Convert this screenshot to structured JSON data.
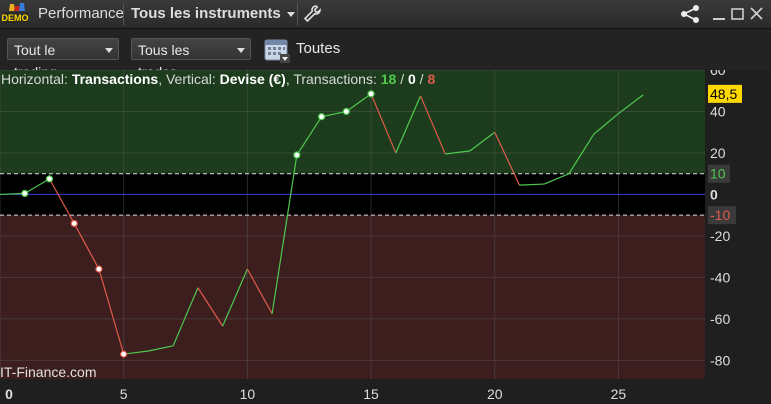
{
  "app": {
    "demo_badge": "DEMO",
    "tab_performance": "Performance",
    "tab_instruments": "Tous les instruments"
  },
  "toolbar": {
    "filter_trading": "Tout le trading",
    "filter_trades": "Tous les trades",
    "period_label": "Toutes"
  },
  "header": {
    "horizontal_label": "Horizontal: ",
    "horizontal_value": "Transactions",
    "vertical_label": ", Vertical: ",
    "vertical_value": "Devise (€)",
    "transactions_label": ", Transactions: ",
    "wins": "18",
    "sep1": " / ",
    "neutral": "0",
    "sep2": " / ",
    "losses": "8"
  },
  "watermark": "IT-Finance.com",
  "colors": {
    "win": "#4ec94e",
    "loss": "#e05a4a",
    "profit_zone": "#1d3c1d",
    "loss_zone": "#3c1e1e",
    "accent_badge": "#ffd800"
  },
  "chart_data": {
    "type": "line",
    "x": [
      0,
      1,
      2,
      3,
      4,
      5,
      6,
      7,
      8,
      9,
      10,
      11,
      12,
      13,
      14,
      15,
      16,
      17,
      18,
      19,
      20,
      21,
      22,
      23,
      24,
      25,
      26
    ],
    "values": [
      0,
      0.5,
      7.5,
      -14,
      -36,
      -77,
      -75.5,
      -73,
      -45,
      -63.5,
      -36,
      -57.5,
      19,
      37.5,
      40,
      48.5,
      20,
      47.5,
      19.5,
      21,
      30,
      4.5,
      5,
      10,
      29,
      39,
      48
    ],
    "xlim": [
      0,
      28.5
    ],
    "ylim": [
      -89,
      60
    ],
    "x_ticks": [
      0,
      5,
      10,
      15,
      20,
      25
    ],
    "y_ticks": [
      60,
      40,
      20,
      0,
      -20,
      -40,
      -60,
      -80
    ],
    "markers_at": [
      1,
      2,
      3,
      4,
      5,
      12,
      13,
      14,
      15
    ],
    "thresholds": {
      "upper": 10,
      "lower": -10
    },
    "upper_label": "10",
    "lower_label": "-10",
    "current_value": 48.5,
    "current_label": "48,5",
    "grid": true
  }
}
